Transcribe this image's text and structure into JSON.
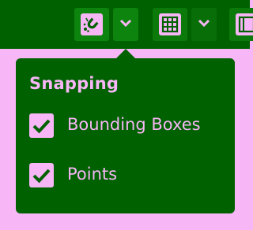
{
  "toolbar": {
    "buttons": [
      {
        "icon": "magnet-snap-icon"
      },
      {
        "icon": "chevron-down-icon"
      },
      {
        "icon": "grid-icon"
      },
      {
        "icon": "chevron-down-icon"
      },
      {
        "icon": "frame-icon"
      }
    ]
  },
  "snapping_popup": {
    "title": "Snapping",
    "options": [
      {
        "label": "Bounding Boxes",
        "checked": true
      },
      {
        "label": "Points",
        "checked": true
      }
    ]
  },
  "colors": {
    "toolbar_bg": "#006100",
    "accent_pink": "#f7b6f5",
    "popup_bg": "#006100",
    "button_bg": "#0d840d"
  }
}
